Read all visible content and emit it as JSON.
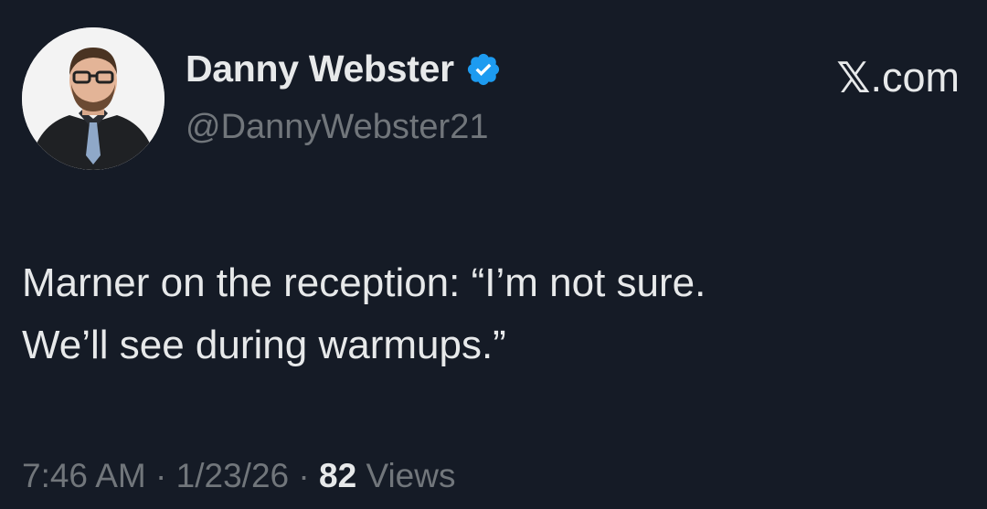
{
  "author": {
    "display_name": "Danny Webster",
    "handle": "@DannyWebster21",
    "verified": true,
    "avatar_icon": "profile-photo"
  },
  "brand": {
    "symbol": "𝕏",
    "suffix": ".com"
  },
  "tweet": {
    "text": "Marner on the reception: “I’m not sure.\nWe’ll see during warmups.”"
  },
  "meta": {
    "time": "7:46 AM",
    "separator": "·",
    "date": "1/23/26",
    "views_count": "82",
    "views_label": "Views"
  },
  "colors": {
    "background": "#151b26",
    "primary_text": "#e7e9ea",
    "secondary_text": "#71767b",
    "verified_badge": "#1d9bf0"
  }
}
